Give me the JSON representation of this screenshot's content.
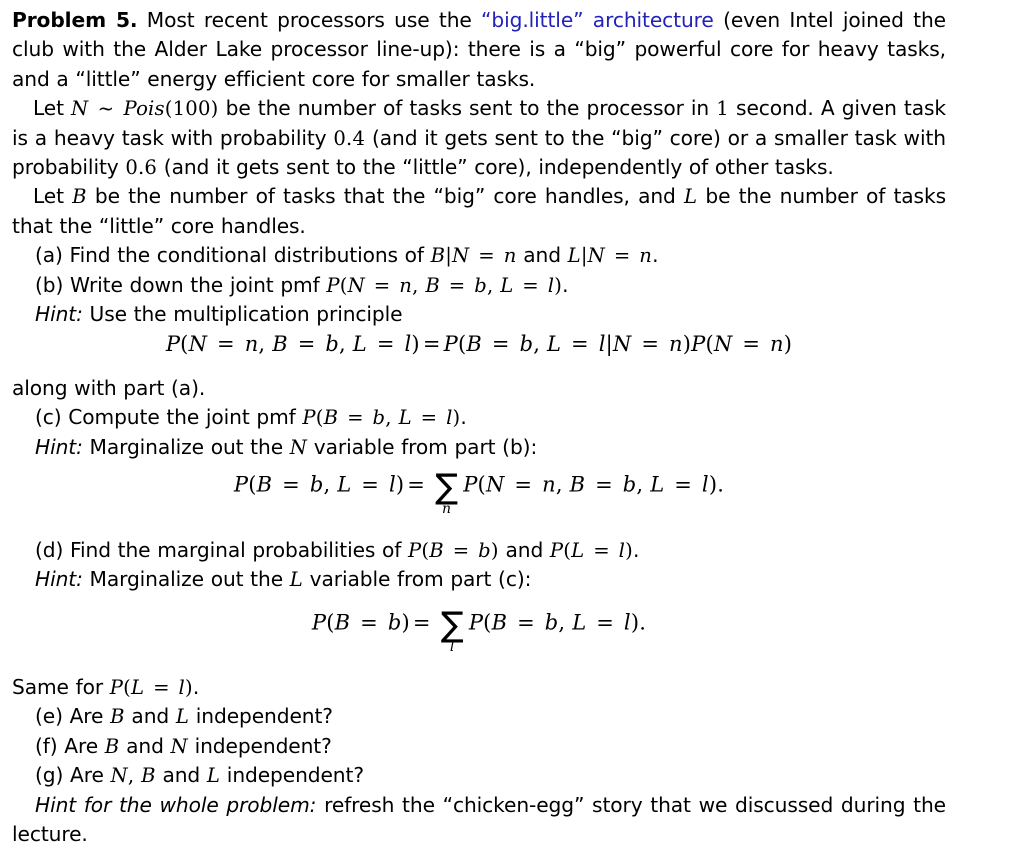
{
  "document": {
    "problem_label": "Problem 5.",
    "link_color": "#2222bb",
    "paragraphs": {
      "intro_after_label": " Most recent processors use the ",
      "intro_link": "“big.little” architecture",
      "intro_rest": " (even Intel joined the club with the Alder Lake processor line-up): there is a “big” powerful core for heavy tasks, and a “little” energy efficient core for smaller tasks.",
      "let_n_1": "Let ",
      "let_n_math": "N ~ Pois(100)",
      "let_n_2": " be the number of tasks sent to the processor in ",
      "let_n_one": "1",
      "let_n_3": " second. A given task is a heavy task with probability ",
      "prob_big": "0.4",
      "let_n_4": " (and it gets sent to the “big” core) or a smaller task with probability ",
      "prob_little": "0.6",
      "let_n_5": " (and it gets sent to the “little” core), independently of other tasks.",
      "let_b_1": "Let ",
      "let_b_var": "B",
      "let_b_2": " be the number of tasks that the “big” core handles, and ",
      "let_l_var": "L",
      "let_b_3": " be the number of tasks that the “little” core handles.",
      "along_with": "along with part (a).",
      "same_for_1": "Same for ",
      "same_for_math": "P(L = l)",
      "same_for_2": "."
    },
    "items": {
      "a_label": "(a)",
      "a_text_1": " Find the conditional distributions of ",
      "a_math_1": "B|N = n",
      "a_text_2": " and ",
      "a_math_2": "L|N = n",
      "a_text_3": ".",
      "b_label": "(b)",
      "b_text_1": " Write down the joint pmf ",
      "b_math_1": "P(N = n, B = b, L = l)",
      "b_text_2": ".",
      "b_hint_label": "Hint:",
      "b_hint_text": " Use the multiplication principle",
      "c_label": "(c)",
      "c_text_1": " Compute the joint pmf ",
      "c_math_1": "P(B = b, L = l)",
      "c_text_2": ".",
      "c_hint_label": "Hint:",
      "c_hint_text_1": " Marginalize out the ",
      "c_hint_math": "N",
      "c_hint_text_2": " variable from part (b):",
      "d_label": "(d)",
      "d_text_1": " Find the marginal probabilities of ",
      "d_math_1": "P(B = b)",
      "d_text_2": " and ",
      "d_math_2": "P(L = l)",
      "d_text_3": ".",
      "d_hint_label": "Hint:",
      "d_hint_text_1": " Marginalize out the ",
      "d_hint_math": "L",
      "d_hint_text_2": " variable from part (c):",
      "e_label": "(e)",
      "e_text_1": " Are ",
      "e_math_1": "B",
      "e_text_2": " and ",
      "e_math_2": "L",
      "e_text_3": " independent?",
      "f_label": "(f)",
      "f_text_1": " Are ",
      "f_math_1": "B",
      "f_text_2": " and ",
      "f_math_2": "N",
      "f_text_3": " independent?",
      "g_label": "(g)",
      "g_text_1": " Are ",
      "g_math_1": "N, B",
      "g_text_2": " and ",
      "g_math_2": "L",
      "g_text_3": " independent?",
      "final_hint_label": "Hint for the whole problem:",
      "final_hint_text": " refresh the “chicken-egg” story that we discussed during the lecture."
    },
    "equations": {
      "eq1": {
        "lhs": "P(N = n, B = b, L = l)",
        "rel": "=",
        "rhs": "P(B = b, L = l|N = n)P(N = n)"
      },
      "eq2": {
        "lhs": "P(B = b, L = l)",
        "rel": "=",
        "sum_index": "n",
        "rhs": "P(N = n, B = b, L = l)."
      },
      "eq3": {
        "lhs": "P(B = b)",
        "rel": "=",
        "sum_index": "l",
        "rhs": "P(B = b, L = l)."
      }
    }
  }
}
